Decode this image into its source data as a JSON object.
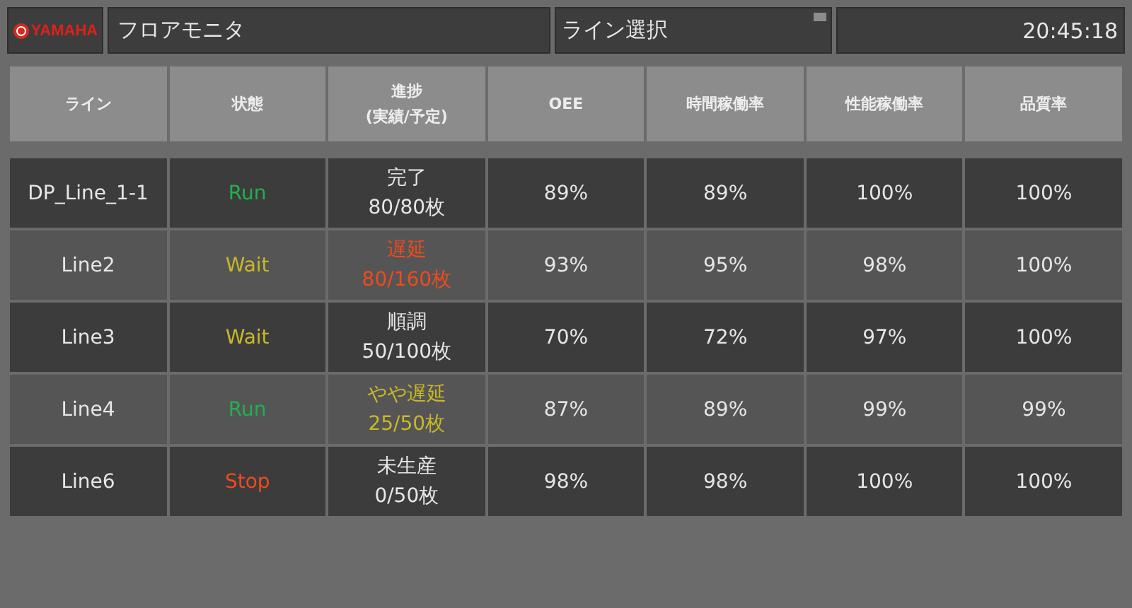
{
  "header": {
    "logo": "YAMAHA",
    "title": "フロアモニタ",
    "line_select": {
      "value": "ライン選択"
    },
    "clock": "20:45:18"
  },
  "table": {
    "columns": [
      "ライン",
      "状態",
      "進捗\n(実績/予定)",
      "OEE",
      "時間稼働率",
      "性能稼働率",
      "品質率"
    ],
    "rows": [
      {
        "line": "DP_Line_1-1",
        "status": {
          "text": "Run",
          "color": "#22b04b"
        },
        "progress": {
          "label": "完了",
          "count": "80/80枚",
          "color": "#e6e6e6"
        },
        "oee": "89%",
        "time_rate": "89%",
        "perf_rate": "100%",
        "quality": "100%"
      },
      {
        "line": "Line2",
        "status": {
          "text": "Wait",
          "color": "#c8b828"
        },
        "progress": {
          "label": "遅延",
          "count": "80/160枚",
          "color": "#f04a1e"
        },
        "oee": "93%",
        "time_rate": "95%",
        "perf_rate": "98%",
        "quality": "100%"
      },
      {
        "line": "Line3",
        "status": {
          "text": "Wait",
          "color": "#c8b828"
        },
        "progress": {
          "label": "順調",
          "count": "50/100枚",
          "color": "#e6e6e6"
        },
        "oee": "70%",
        "time_rate": "72%",
        "perf_rate": "97%",
        "quality": "100%"
      },
      {
        "line": "Line4",
        "status": {
          "text": "Run",
          "color": "#22b04b"
        },
        "progress": {
          "label": "やや遅延",
          "count": "25/50枚",
          "color": "#c8b828"
        },
        "oee": "87%",
        "time_rate": "89%",
        "perf_rate": "99%",
        "quality": "99%"
      },
      {
        "line": "Line6",
        "status": {
          "text": "Stop",
          "color": "#f04a1e"
        },
        "progress": {
          "label": "未生産",
          "count": "0/50枚",
          "color": "#e6e6e6"
        },
        "oee": "98%",
        "time_rate": "98%",
        "perf_rate": "100%",
        "quality": "100%"
      }
    ]
  }
}
